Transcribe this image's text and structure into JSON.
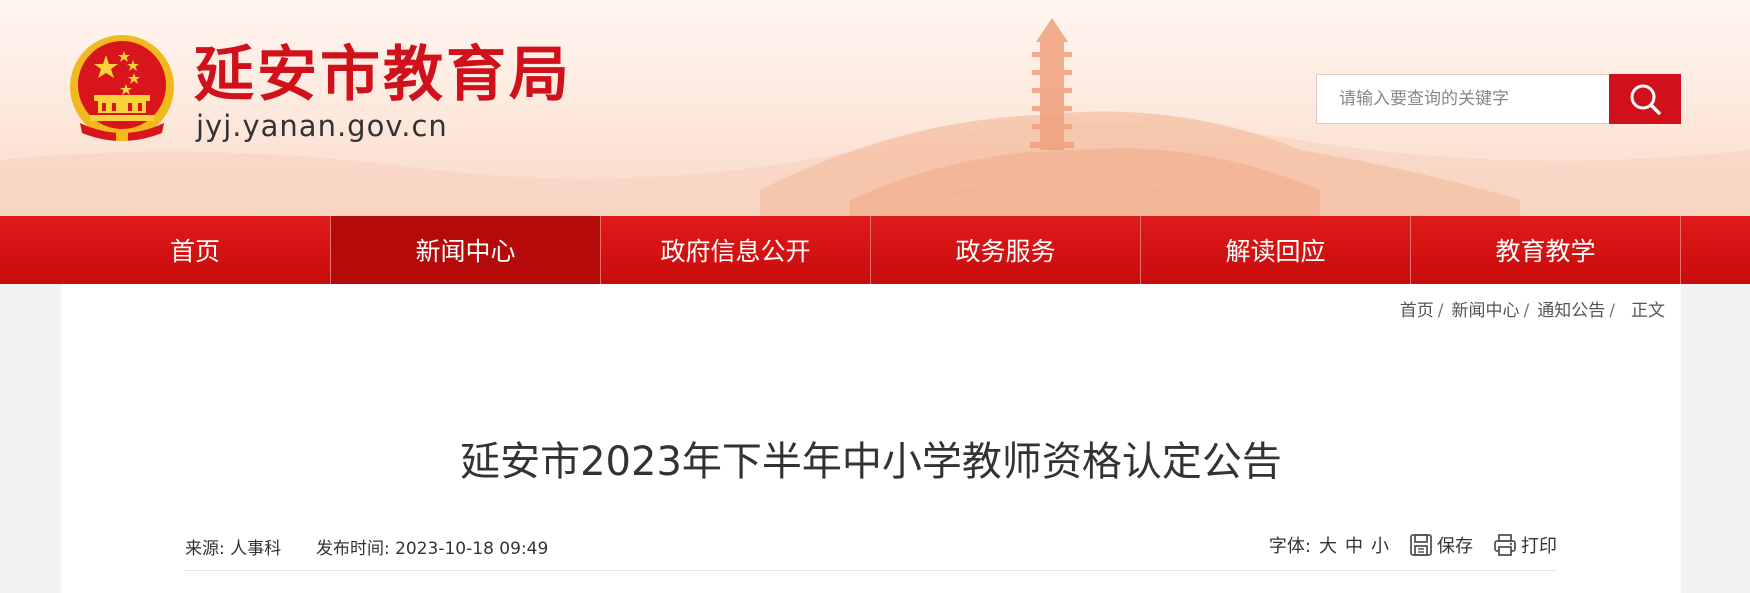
{
  "header": {
    "title": "延安市教育局",
    "domain": "jyj.yanan.gov.cn",
    "emblem_icon": "national-emblem-icon",
    "search": {
      "placeholder": "请输入要查询的关键字",
      "button_icon": "search-icon"
    }
  },
  "nav": {
    "items": [
      {
        "label": "首页",
        "active": false
      },
      {
        "label": "新闻中心",
        "active": true
      },
      {
        "label": "政府信息公开",
        "active": false
      },
      {
        "label": "政务服务",
        "active": false
      },
      {
        "label": "解读回应",
        "active": false
      },
      {
        "label": "教育教学",
        "active": false
      }
    ]
  },
  "breadcrumb": {
    "items": [
      "首页",
      "新闻中心",
      "通知公告"
    ],
    "separator": "/",
    "current": "正文"
  },
  "article": {
    "title": "延安市2023年下半年中小学教师资格认定公告",
    "source_label": "来源:",
    "source": "人事科",
    "publish_label": "发布时间:",
    "publish_time": "2023-10-18 09:49"
  },
  "tools": {
    "font_label": "字体:",
    "font_large": "大",
    "font_medium": "中",
    "font_small": "小",
    "save_label": "保存",
    "save_icon": "save-icon",
    "print_label": "打印",
    "print_icon": "print-icon"
  },
  "colors": {
    "brand_red": "#d0101a",
    "nav_red": "#d81414",
    "nav_active": "#b50a0a"
  }
}
